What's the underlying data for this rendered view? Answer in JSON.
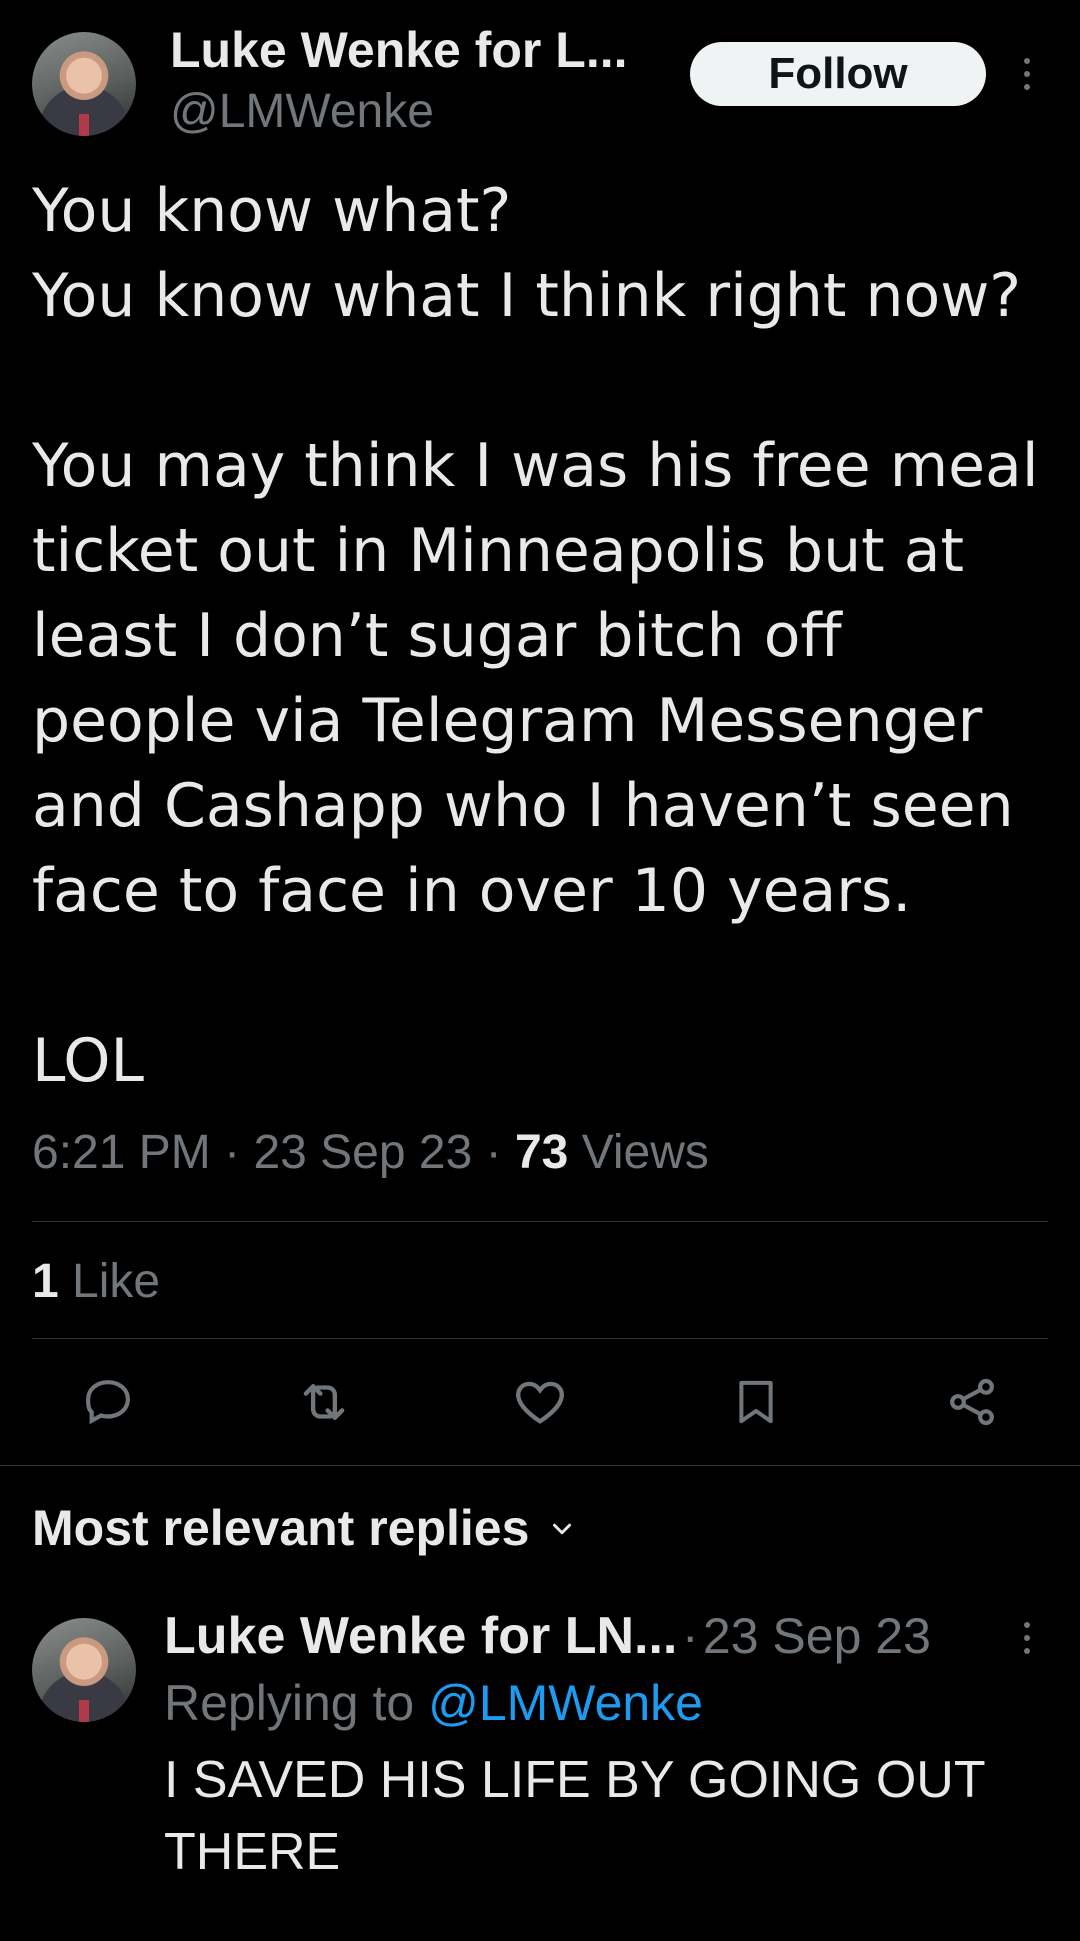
{
  "tweet": {
    "author_name": "Luke Wenke for L...",
    "author_handle": "@LMWenke",
    "follow_label": "Follow",
    "text": "You know what?\nYou know what I think right now?\n\nYou may think I was his free meal ticket out in Minneapolis but at least I don’t sugar bitch off people via Telegram Messenger and Cashapp who I haven’t seen face to face in over 10 years.\n\nLOL",
    "time": "6:21 PM",
    "date": "23 Sep 23",
    "separator": "·",
    "views_count": "73",
    "views_label": "Views",
    "likes_count": "1",
    "likes_label": "Like"
  },
  "actions": [
    {
      "icon": "reply-icon"
    },
    {
      "icon": "retweet-icon"
    },
    {
      "icon": "heart-icon"
    },
    {
      "icon": "bookmark-icon"
    },
    {
      "icon": "share-icon"
    }
  ],
  "replies": {
    "header": "Most relevant replies",
    "items": [
      {
        "author_name": "Luke Wenke for LN...",
        "separator": "·",
        "date": "23 Sep 23",
        "replying_prefix": "Replying to",
        "replying_handle": "@LMWenke",
        "text": "I SAVED HIS LIFE BY GOING OUT THERE"
      }
    ]
  },
  "colors": {
    "background": "#000000",
    "text": "#e7e9ea",
    "muted": "#71767b",
    "link": "#1d9bf0",
    "divider": "#2f3336"
  }
}
